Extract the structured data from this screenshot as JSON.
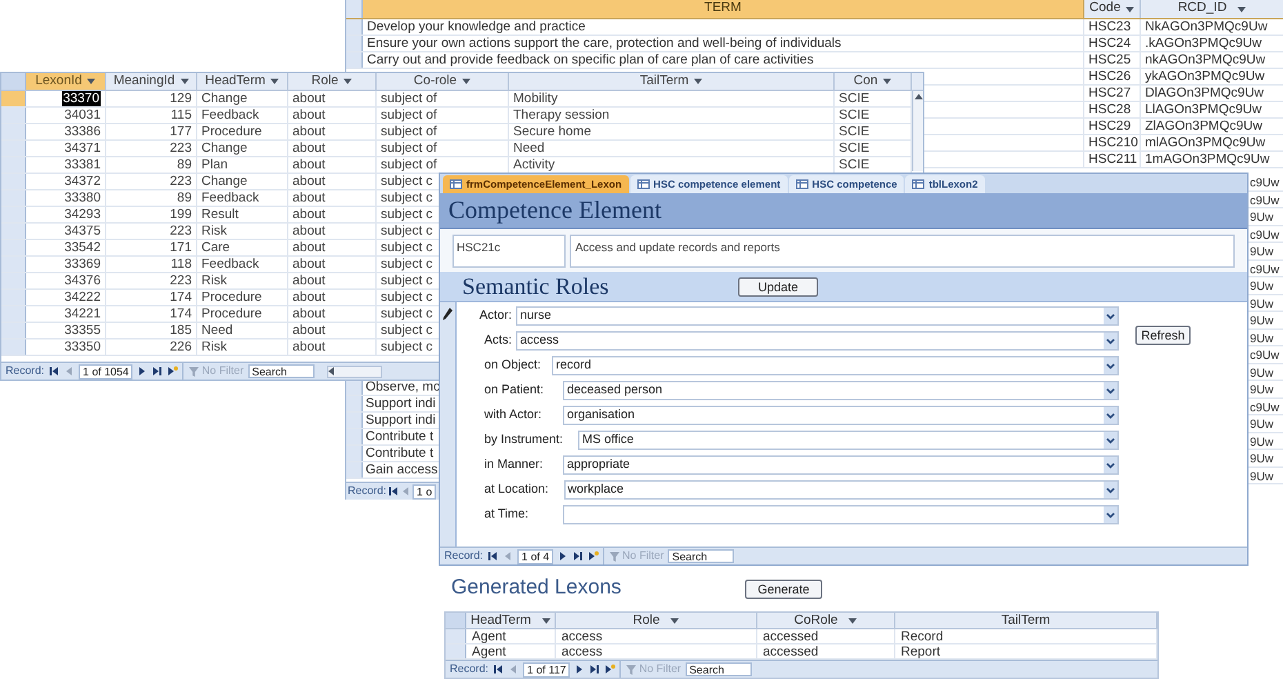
{
  "term_table": {
    "columns": [
      "TERM",
      "Code",
      "RCD_ID"
    ],
    "rows": [
      {
        "term": "Develop your knowledge and practice",
        "code": "HSC23",
        "rcd_id": "NkAGOn3PMQc9Uw"
      },
      {
        "term": "Ensure your own actions support the care, protection and well-being of individuals",
        "code": "HSC24",
        "rcd_id": ".kAGOn3PMQc9Uw"
      },
      {
        "term": "Carry out and provide feedback on specific plan of care plan of care activities",
        "code": "HSC25",
        "rcd_id": "nkAGOn3PMQc9Uw"
      },
      {
        "code": "HSC26",
        "rcd_id": "ykAGOn3PMQc9Uw"
      },
      {
        "code": "HSC27",
        "rcd_id": "DlAGOn3PMQc9Uw"
      },
      {
        "code": "HSC28",
        "rcd_id": "LlAGOn3PMQc9Uw"
      },
      {
        "code": "HSC29",
        "rcd_id": "ZlAGOn3PMQc9Uw"
      },
      {
        "code": "HSC210",
        "rcd_id": "mlAGOn3PMQc9Uw"
      },
      {
        "code": "HSC211",
        "rcd_id": "1mAGOn3PMQc9Uw"
      }
    ],
    "rcd_id_fragments": [
      "c9Uw",
      "c9Uw",
      "9Uw",
      "c9Uw",
      "9Uw",
      "c9Uw",
      "9Uw",
      "9Uw",
      "9Uw",
      "9Uw",
      "c9Uw",
      "9Uw",
      "9Uw",
      "c9Uw",
      "9Uw",
      "9Uw",
      "9Uw",
      "9Uw"
    ],
    "term_fragments": [
      "Observe, mc",
      "Support indi",
      "Support indi",
      "Contribute t",
      "Contribute t",
      "Gain access"
    ],
    "record_bar": {
      "label": "Record:",
      "position": "1 o"
    }
  },
  "lexon_table": {
    "columns": [
      "LexonId",
      "MeaningId",
      "HeadTerm",
      "Role",
      "Co-role",
      "TailTerm",
      "Con"
    ],
    "rows": [
      {
        "lexon_id": "33370",
        "meaning_id": "129",
        "head_term": "Change",
        "role": "about",
        "co_role": "subject of",
        "tail_term": "Mobility",
        "con": "SCIE",
        "selected": true
      },
      {
        "lexon_id": "34031",
        "meaning_id": "115",
        "head_term": "Feedback",
        "role": "about",
        "co_role": "subject of",
        "tail_term": "Therapy session",
        "con": "SCIE",
        "selected": false
      },
      {
        "lexon_id": "33386",
        "meaning_id": "177",
        "head_term": "Procedure",
        "role": "about",
        "co_role": "subject of",
        "tail_term": "Secure home",
        "con": "SCIE",
        "selected": false
      },
      {
        "lexon_id": "34371",
        "meaning_id": "223",
        "head_term": "Change",
        "role": "about",
        "co_role": "subject of",
        "tail_term": "Need",
        "con": "SCIE",
        "selected": false
      },
      {
        "lexon_id": "33381",
        "meaning_id": "89",
        "head_term": "Plan",
        "role": "about",
        "co_role": "subject of",
        "tail_term": "Activity",
        "con": "SCIE",
        "selected": false
      },
      {
        "lexon_id": "34372",
        "meaning_id": "223",
        "head_term": "Change",
        "role": "about",
        "co_role": "subject c",
        "selected": false
      },
      {
        "lexon_id": "33380",
        "meaning_id": "89",
        "head_term": "Feedback",
        "role": "about",
        "co_role": "subject c",
        "selected": false
      },
      {
        "lexon_id": "34293",
        "meaning_id": "199",
        "head_term": "Result",
        "role": "about",
        "co_role": "subject c",
        "selected": false
      },
      {
        "lexon_id": "34375",
        "meaning_id": "223",
        "head_term": "Risk",
        "role": "about",
        "co_role": "subject c",
        "selected": false
      },
      {
        "lexon_id": "33542",
        "meaning_id": "171",
        "head_term": "Care",
        "role": "about",
        "co_role": "subject c",
        "selected": false
      },
      {
        "lexon_id": "33369",
        "meaning_id": "118",
        "head_term": "Feedback",
        "role": "about",
        "co_role": "subject c",
        "selected": false
      },
      {
        "lexon_id": "34376",
        "meaning_id": "223",
        "head_term": "Risk",
        "role": "about",
        "co_role": "subject c",
        "selected": false
      },
      {
        "lexon_id": "34222",
        "meaning_id": "174",
        "head_term": "Procedure",
        "role": "about",
        "co_role": "subject c",
        "selected": false
      },
      {
        "lexon_id": "34221",
        "meaning_id": "174",
        "head_term": "Procedure",
        "role": "about",
        "co_role": "subject c",
        "selected": false
      },
      {
        "lexon_id": "33355",
        "meaning_id": "185",
        "head_term": "Need",
        "role": "about",
        "co_role": "subject c",
        "selected": false
      },
      {
        "lexon_id": "33350",
        "meaning_id": "226",
        "head_term": "Risk",
        "role": "about",
        "co_role": "subject c",
        "selected": false
      }
    ],
    "record_bar": {
      "label": "Record:",
      "position": "1 of 1054",
      "filter": "No Filter",
      "search": "Search"
    }
  },
  "form": {
    "tabs": [
      {
        "label": "frmCompetenceElement_Lexon",
        "selected": true
      },
      {
        "label": "HSC competence element",
        "selected": false
      },
      {
        "label": "HSC competence",
        "selected": false
      },
      {
        "label": "tblLexon2",
        "selected": false
      }
    ],
    "title": "Competence Element",
    "element_code": "HSC21c",
    "element_description": "Access and update records and reports",
    "section_title": "Semantic Roles",
    "update_button": "Update",
    "refresh_button": "Refresh",
    "fields": [
      {
        "label": "Actor:",
        "value": "nurse",
        "kind": "main"
      },
      {
        "label": "Acts:",
        "value": "access",
        "kind": "main"
      },
      {
        "label": "on Object:",
        "value": "record",
        "kind": "role"
      },
      {
        "label": "on Patient:",
        "value": "deceased person",
        "kind": "role"
      },
      {
        "label": "with Actor:",
        "value": "organisation",
        "kind": "role"
      },
      {
        "label": "by Instrument:",
        "value": "MS office",
        "kind": "role"
      },
      {
        "label": "in Manner:",
        "value": "appropriate",
        "kind": "role"
      },
      {
        "label": "at Location:",
        "value": "workplace",
        "kind": "role"
      },
      {
        "label": "at Time:",
        "kind": "role"
      }
    ],
    "record_bar": {
      "label": "Record:",
      "position": "1 of 4",
      "filter": "No Filter",
      "search": "Search"
    }
  },
  "generated": {
    "title": "Generated Lexons",
    "generate_button": "Generate",
    "columns": [
      "HeadTerm",
      "Role",
      "CoRole",
      "TailTerm"
    ],
    "rows": [
      {
        "head_term": "Agent",
        "role": "access",
        "co_role": "accessed",
        "tail_term": "Record"
      },
      {
        "head_term": "Agent",
        "role": "access",
        "co_role": "accessed",
        "tail_term": "Report"
      }
    ],
    "record_bar": {
      "label": "Record:",
      "position": "1 of 117",
      "filter": "No Filter",
      "search": "Search"
    }
  }
}
